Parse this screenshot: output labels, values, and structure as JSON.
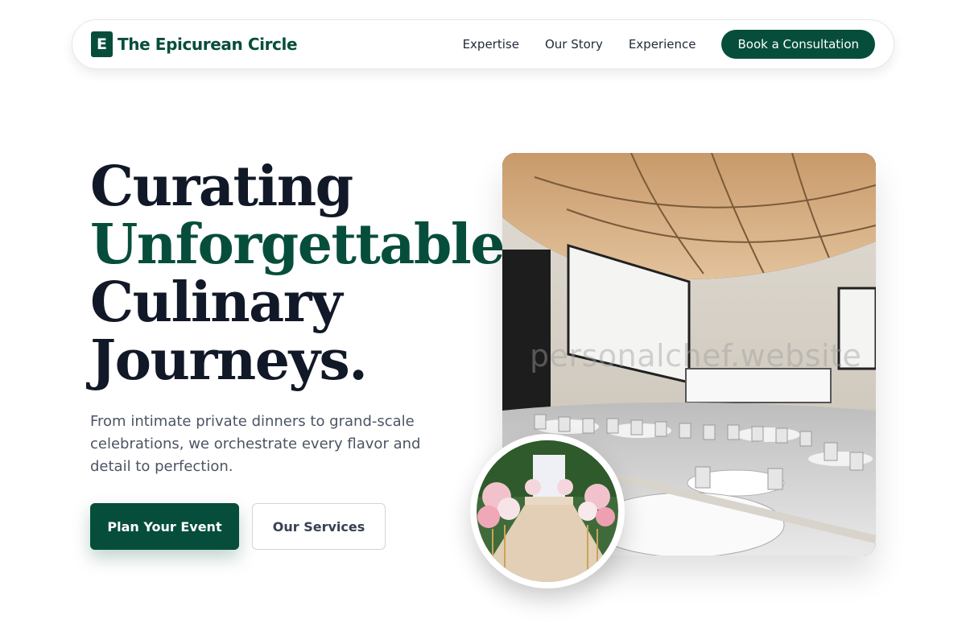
{
  "nav": {
    "logo_letter": "E",
    "brand": "The Epicurean Circle",
    "links": [
      "Expertise",
      "Our Story",
      "Experience"
    ],
    "cta": "Book a Consultation"
  },
  "hero": {
    "headline_line1": "Curating",
    "headline_line2": "Unforgettable",
    "headline_line3": "Culinary",
    "headline_line4": "Journeys.",
    "subtext": "From intimate private dinners to grand-scale celebrations, we orchestrate every flavor and detail to perfection.",
    "primary_button": "Plan Your Event",
    "secondary_button": "Our Services"
  },
  "media": {
    "main_image": "banquet-hall-photo",
    "watermark": "personalchef.website",
    "inset_image": "wedding-aisle-flowers-photo"
  },
  "colors": {
    "brand_green": "#064e3b",
    "heading_dark": "#111827",
    "body_gray": "#4b5563"
  }
}
